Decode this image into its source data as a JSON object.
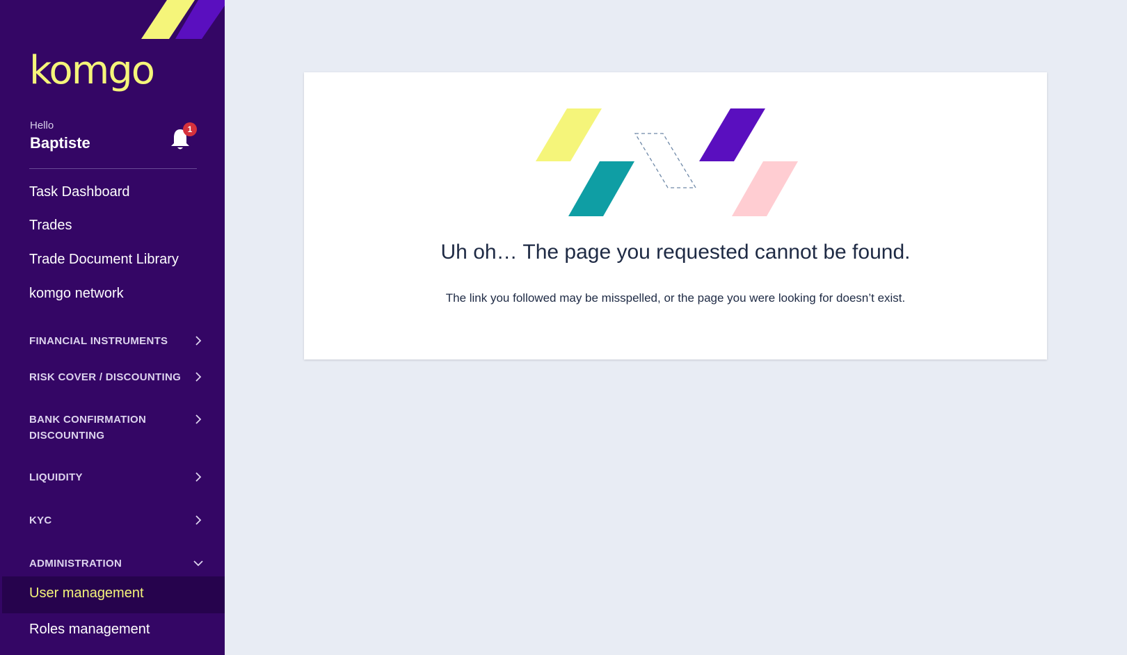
{
  "brand": {
    "logo_text": "komgo",
    "colors": {
      "sidebar": "#340665",
      "accent_yellow": "#f5f57a",
      "purple": "#5a0fbf",
      "teal": "#0f9ea4",
      "pink": "#ffcdd2"
    }
  },
  "user": {
    "hello": "Hello",
    "name": "Baptiste",
    "notification_count": "1",
    "bell_icon": "bell-icon"
  },
  "nav": {
    "links": [
      {
        "label": "Task Dashboard"
      },
      {
        "label": "Trades"
      },
      {
        "label": "Trade Document Library"
      },
      {
        "label": "komgo network"
      }
    ],
    "sections": [
      {
        "label": "FINANCIAL INSTRUMENTS",
        "icon": "chevron-right-icon"
      },
      {
        "label": "RISK COVER / DISCOUNTING",
        "icon": "chevron-right-icon"
      },
      {
        "label": "BANK CONFIRMATION DISCOUNTING",
        "icon": "chevron-right-icon"
      },
      {
        "label": "LIQUIDITY",
        "icon": "chevron-right-icon"
      },
      {
        "label": "KYC",
        "icon": "chevron-right-icon"
      },
      {
        "label": "ADMINISTRATION",
        "icon": "chevron-down-icon"
      }
    ],
    "admin_items": [
      {
        "label": "User management",
        "active": true
      },
      {
        "label": "Roles management",
        "active": false
      }
    ]
  },
  "error": {
    "title": "Uh oh… The page you requested cannot be found.",
    "description": "The link you followed may be misspelled, or the page you were looking for doesn’t exist."
  }
}
